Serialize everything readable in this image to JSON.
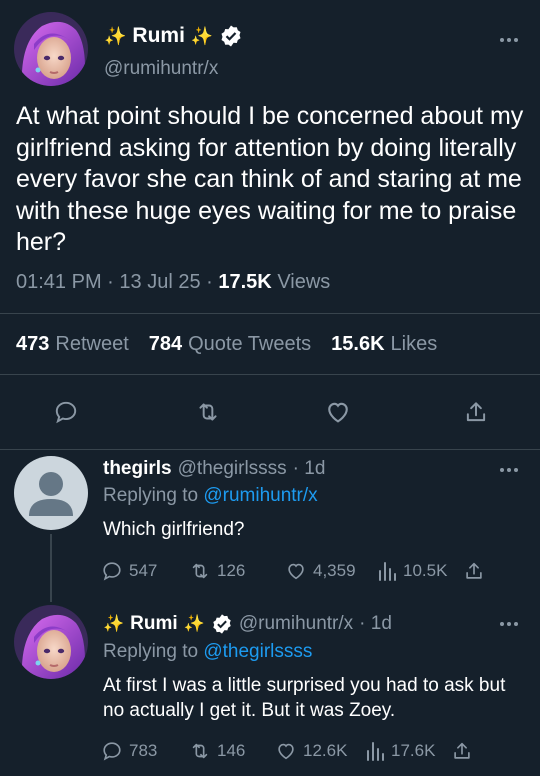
{
  "tweet": {
    "display_name": "Rumi",
    "sparkle": "✨",
    "handle": "@rumihuntr/x",
    "text": "At what point should I be concerned about my girlfriend asking for attention by doing literally every favor she can think of and staring at me with these huge eyes waiting for me to praise her?",
    "time": "01:41 PM",
    "sep": "·",
    "date": "13 Jul 25",
    "views_count": "17.5K",
    "views_label": "Views",
    "retweets_count": "473",
    "retweets_label": "Retweet",
    "quotes_count": "784",
    "quotes_label": "Quote Tweets",
    "likes_count": "15.6K",
    "likes_label": "Likes"
  },
  "replies": [
    {
      "display_name": "thegirls",
      "handle": "@thegirlssss",
      "age": "· 1d",
      "replying_prefix": "Replying to",
      "replying_to": "@rumihuntr/x",
      "text": "Which girlfriend?",
      "replies": "547",
      "retweets": "126",
      "likes": "4,359",
      "views": "10.5K"
    },
    {
      "display_name": "Rumi",
      "sparkle": "✨",
      "handle": "@rumihuntr/x",
      "age": "· 1d",
      "replying_prefix": "Replying to",
      "replying_to": "@thegirlssss",
      "text": "At first I was a little surprised you had to ask but no actually I get it. But it was Zoey.",
      "replies": "783",
      "retweets": "146",
      "likes": "12.6K",
      "views": "17.6K"
    }
  ],
  "colors": {
    "background": "#15202b",
    "muted": "#8b98a5",
    "accent": "#1d9bf0",
    "divider": "#38444d"
  },
  "icons": [
    "verified-badge-icon",
    "more-icon",
    "reply-icon",
    "retweet-icon",
    "like-icon",
    "share-icon",
    "views-icon",
    "default-avatar-icon"
  ]
}
